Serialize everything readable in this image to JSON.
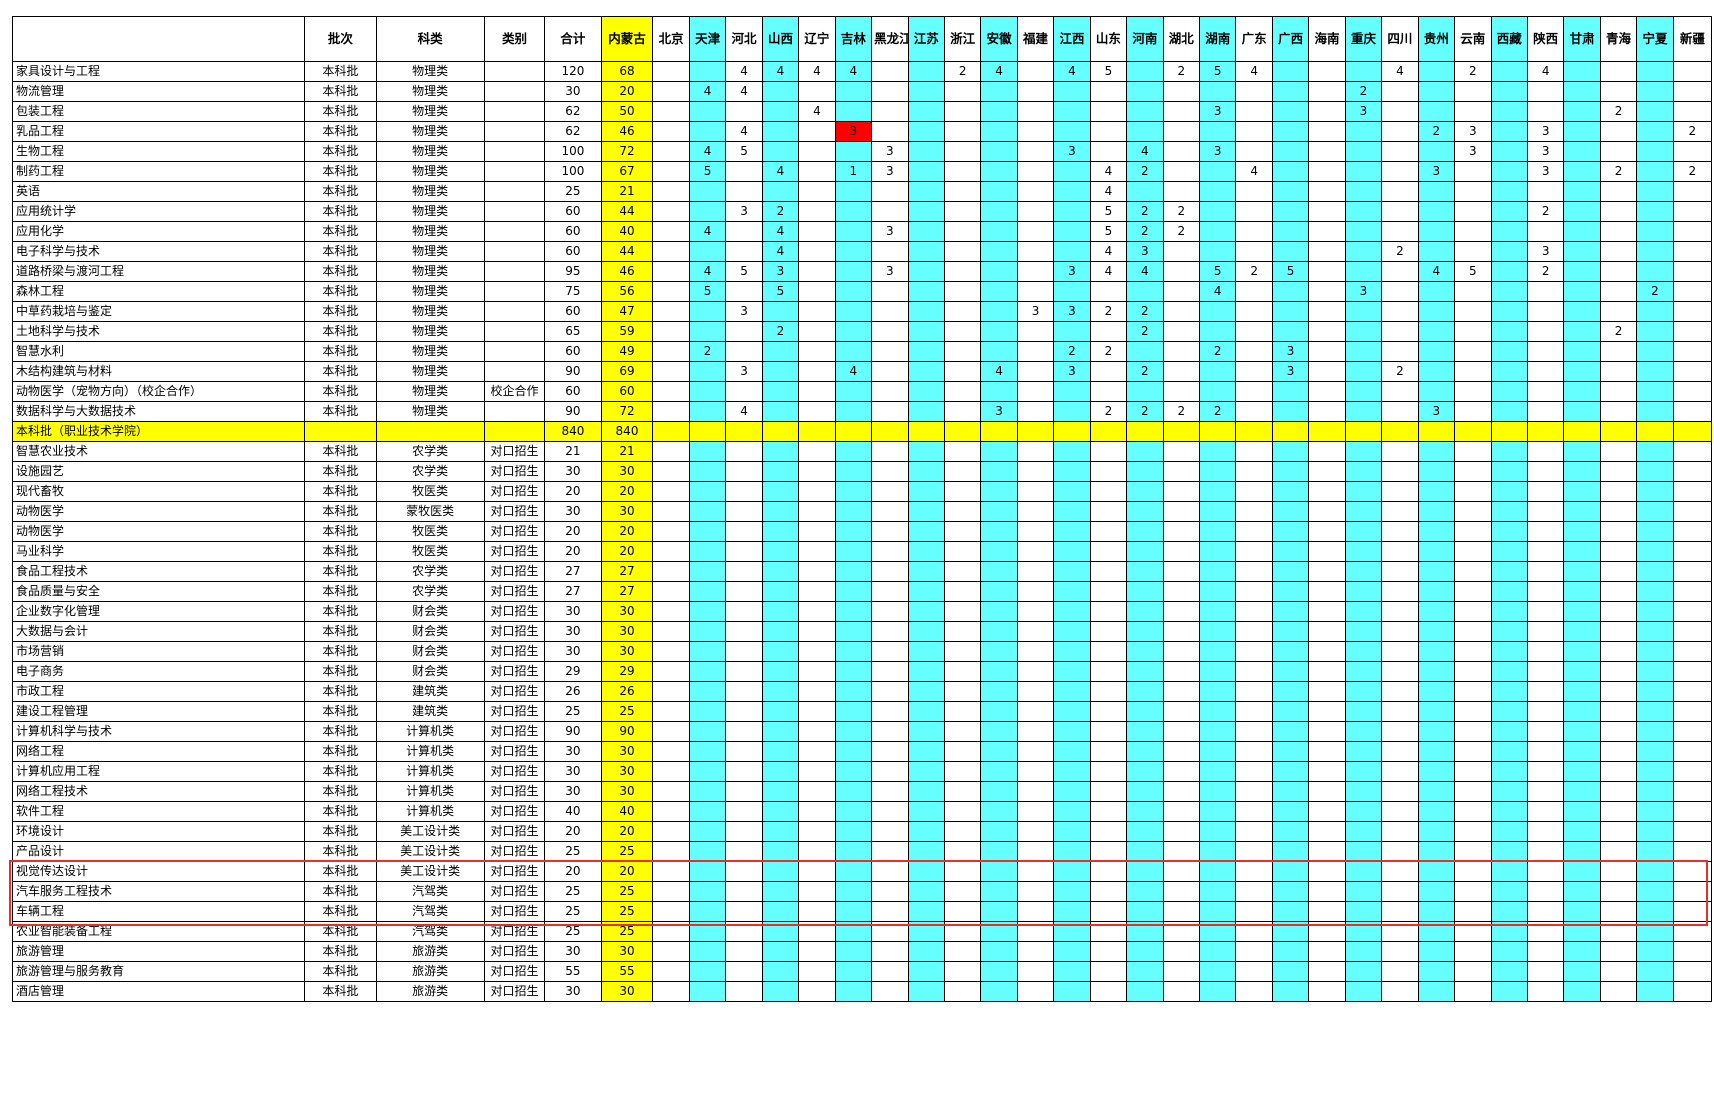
{
  "headers": [
    "",
    "批次",
    "科类",
    "类别",
    "合计",
    "内蒙古",
    "北京",
    "天津",
    "河北",
    "山西",
    "辽宁",
    "吉林",
    "黑龙江",
    "江苏",
    "浙江",
    "安徽",
    "福建",
    "江西",
    "山东",
    "河南",
    "湖北",
    "湖南",
    "广东",
    "广西",
    "海南",
    "重庆",
    "四川",
    "贵州",
    "云南",
    "西藏",
    "陕西",
    "甘肃",
    "青海",
    "宁夏",
    "新疆"
  ],
  "cyan_columns": [
    7,
    9,
    11,
    13,
    15,
    17,
    19,
    21,
    23,
    25,
    27,
    29,
    31,
    33
  ],
  "yellow_column": 5,
  "colors": {
    "cyan": "#66ffff",
    "yellow": "#ffff00",
    "red": "#ff0000",
    "highlight_box": "#e8302a"
  },
  "highlight_box_rows": [
    40,
    42
  ],
  "rows": [
    {
      "cells": [
        "家具设计与工程",
        "本科批",
        "物理类",
        "",
        "120",
        "68",
        "",
        "",
        "4",
        "4",
        "4",
        "4",
        "",
        "",
        "2",
        "4",
        "",
        "4",
        "5",
        "",
        "2",
        "5",
        "4",
        "",
        "",
        "",
        "4",
        "",
        "2",
        "",
        "4",
        "",
        "",
        "",
        ""
      ]
    },
    {
      "cells": [
        "物流管理",
        "本科批",
        "物理类",
        "",
        "30",
        "20",
        "",
        "4",
        "4",
        "",
        "",
        "",
        "",
        "",
        "",
        "",
        "",
        "",
        "",
        "",
        "",
        "",
        "",
        "",
        "",
        "2",
        "",
        "",
        "",
        "",
        "",
        "",
        "",
        "",
        ""
      ]
    },
    {
      "cells": [
        "包装工程",
        "本科批",
        "物理类",
        "",
        "62",
        "50",
        "",
        "",
        "",
        "",
        "4",
        "",
        "",
        "",
        "",
        "",
        "",
        "",
        "",
        "",
        "",
        "3",
        "",
        "",
        "",
        "3",
        "",
        "",
        "",
        "",
        "",
        "",
        "2",
        "",
        ""
      ]
    },
    {
      "cells": [
        "乳品工程",
        "本科批",
        "物理类",
        "",
        "62",
        "46",
        "",
        "",
        "4",
        "",
        "",
        "3",
        "",
        "",
        "",
        "",
        "",
        "",
        "",
        "",
        "",
        "",
        "",
        "",
        "",
        "",
        "",
        "2",
        "3",
        "",
        "3",
        "",
        "",
        "",
        "2"
      ],
      "red_cols": [
        11
      ]
    },
    {
      "cells": [
        "生物工程",
        "本科批",
        "物理类",
        "",
        "100",
        "72",
        "",
        "4",
        "5",
        "",
        "",
        "",
        "3",
        "",
        "",
        "",
        "",
        "3",
        "",
        "4",
        "",
        "3",
        "",
        "",
        "",
        "",
        "",
        "",
        "3",
        "",
        "3",
        "",
        "",
        "",
        ""
      ]
    },
    {
      "cells": [
        "制药工程",
        "本科批",
        "物理类",
        "",
        "100",
        "67",
        "",
        "5",
        "",
        "4",
        "",
        "1",
        "3",
        "",
        "",
        "",
        "",
        "",
        "4",
        "2",
        "",
        "",
        "4",
        "",
        "",
        "",
        "",
        "3",
        "",
        "",
        "3",
        "",
        "2",
        "",
        "2"
      ]
    },
    {
      "cells": [
        "英语",
        "本科批",
        "物理类",
        "",
        "25",
        "21",
        "",
        "",
        "",
        "",
        "",
        "",
        "",
        "",
        "",
        "",
        "",
        "",
        "4",
        "",
        "",
        "",
        "",
        "",
        "",
        "",
        "",
        "",
        "",
        "",
        "",
        "",
        "",
        "",
        ""
      ]
    },
    {
      "cells": [
        "应用统计学",
        "本科批",
        "物理类",
        "",
        "60",
        "44",
        "",
        "",
        "3",
        "2",
        "",
        "",
        "",
        "",
        "",
        "",
        "",
        "",
        "5",
        "2",
        "2",
        "",
        "",
        "",
        "",
        "",
        "",
        "",
        "",
        "",
        "2",
        "",
        "",
        "",
        ""
      ]
    },
    {
      "cells": [
        "应用化学",
        "本科批",
        "物理类",
        "",
        "60",
        "40",
        "",
        "4",
        "",
        "4",
        "",
        "",
        "3",
        "",
        "",
        "",
        "",
        "",
        "5",
        "2",
        "2",
        "",
        "",
        "",
        "",
        "",
        "",
        "",
        "",
        "",
        "",
        "",
        "",
        "",
        ""
      ]
    },
    {
      "cells": [
        "电子科学与技术",
        "本科批",
        "物理类",
        "",
        "60",
        "44",
        "",
        "",
        "",
        "4",
        "",
        "",
        "",
        "",
        "",
        "",
        "",
        "",
        "4",
        "3",
        "",
        "",
        "",
        "",
        "",
        "",
        "2",
        "",
        "",
        "",
        "3",
        "",
        "",
        "",
        ""
      ]
    },
    {
      "cells": [
        "道路桥梁与渡河工程",
        "本科批",
        "物理类",
        "",
        "95",
        "46",
        "",
        "4",
        "5",
        "3",
        "",
        "",
        "3",
        "",
        "",
        "",
        "",
        "3",
        "4",
        "4",
        "",
        "5",
        "2",
        "5",
        "",
        "",
        "",
        "4",
        "5",
        "",
        "2",
        "",
        "",
        "",
        ""
      ]
    },
    {
      "cells": [
        "森林工程",
        "本科批",
        "物理类",
        "",
        "75",
        "56",
        "",
        "5",
        "",
        "5",
        "",
        "",
        "",
        "",
        "",
        "",
        "",
        "",
        "",
        "",
        "",
        "4",
        "",
        "",
        "",
        "3",
        "",
        "",
        "",
        "",
        "",
        "",
        "",
        "2",
        ""
      ]
    },
    {
      "cells": [
        "中草药栽培与鉴定",
        "本科批",
        "物理类",
        "",
        "60",
        "47",
        "",
        "",
        "3",
        "",
        "",
        "",
        "",
        "",
        "",
        "",
        "3",
        "3",
        "2",
        "2",
        "",
        "",
        "",
        "",
        "",
        "",
        "",
        "",
        "",
        "",
        "",
        "",
        "",
        "",
        ""
      ]
    },
    {
      "cells": [
        "土地科学与技术",
        "本科批",
        "物理类",
        "",
        "65",
        "59",
        "",
        "",
        "",
        "2",
        "",
        "",
        "",
        "",
        "",
        "",
        "",
        "",
        "",
        "2",
        "",
        "",
        "",
        "",
        "",
        "",
        "",
        "",
        "",
        "",
        "",
        "",
        "2",
        "",
        ""
      ]
    },
    {
      "cells": [
        "智慧水利",
        "本科批",
        "物理类",
        "",
        "60",
        "49",
        "",
        "2",
        "",
        "",
        "",
        "",
        "",
        "",
        "",
        "",
        "",
        "2",
        "2",
        "",
        "",
        "2",
        "",
        "3",
        "",
        "",
        "",
        "",
        "",
        "",
        "",
        "",
        "",
        "",
        ""
      ]
    },
    {
      "cells": [
        "木结构建筑与材料",
        "本科批",
        "物理类",
        "",
        "90",
        "69",
        "",
        "",
        "3",
        "",
        "",
        "4",
        "",
        "",
        "",
        "4",
        "",
        "3",
        "",
        "2",
        "",
        "",
        "",
        "3",
        "",
        "",
        "2",
        "",
        "",
        "",
        "",
        "",
        "",
        "",
        ""
      ]
    },
    {
      "cells": [
        "动物医学（宠物方向）（校企合作）",
        "本科批",
        "物理类",
        "校企合作",
        "60",
        "60",
        "",
        "",
        "",
        "",
        "",
        "",
        "",
        "",
        "",
        "",
        "",
        "",
        "",
        "",
        "",
        "",
        "",
        "",
        "",
        "",
        "",
        "",
        "",
        "",
        "",
        "",
        "",
        "",
        ""
      ]
    },
    {
      "cells": [
        "数据科学与大数据技术",
        "本科批",
        "物理类",
        "",
        "90",
        "72",
        "",
        "",
        "4",
        "",
        "",
        "",
        "",
        "",
        "",
        "3",
        "",
        "",
        "2",
        "2",
        "2",
        "2",
        "",
        "",
        "",
        "",
        "",
        "3",
        "",
        "",
        "",
        "",
        "",
        "",
        ""
      ]
    },
    {
      "section": true,
      "cells": [
        "本科批（职业技术学院）",
        "",
        "",
        "",
        "840",
        "840"
      ]
    },
    {
      "cells": [
        "智慧农业技术",
        "本科批",
        "农学类",
        "对口招生",
        "21",
        "21"
      ]
    },
    {
      "cells": [
        "设施园艺",
        "本科批",
        "农学类",
        "对口招生",
        "30",
        "30"
      ]
    },
    {
      "cells": [
        "现代畜牧",
        "本科批",
        "牧医类",
        "对口招生",
        "20",
        "20"
      ]
    },
    {
      "cells": [
        "动物医学",
        "本科批",
        "蒙牧医类",
        "对口招生",
        "30",
        "30"
      ]
    },
    {
      "cells": [
        "动物医学",
        "本科批",
        "牧医类",
        "对口招生",
        "20",
        "20"
      ]
    },
    {
      "cells": [
        "马业科学",
        "本科批",
        "牧医类",
        "对口招生",
        "20",
        "20"
      ]
    },
    {
      "cells": [
        "食品工程技术",
        "本科批",
        "农学类",
        "对口招生",
        "27",
        "27"
      ]
    },
    {
      "cells": [
        "食品质量与安全",
        "本科批",
        "农学类",
        "对口招生",
        "27",
        "27"
      ]
    },
    {
      "cells": [
        "企业数字化管理",
        "本科批",
        "财会类",
        "对口招生",
        "30",
        "30"
      ]
    },
    {
      "cells": [
        "大数据与会计",
        "本科批",
        "财会类",
        "对口招生",
        "30",
        "30"
      ]
    },
    {
      "cells": [
        "市场营销",
        "本科批",
        "财会类",
        "对口招生",
        "30",
        "30"
      ]
    },
    {
      "cells": [
        "电子商务",
        "本科批",
        "财会类",
        "对口招生",
        "29",
        "29"
      ]
    },
    {
      "cells": [
        "市政工程",
        "本科批",
        "建筑类",
        "对口招生",
        "26",
        "26"
      ]
    },
    {
      "cells": [
        "建设工程管理",
        "本科批",
        "建筑类",
        "对口招生",
        "25",
        "25"
      ]
    },
    {
      "cells": [
        "计算机科学与技术",
        "本科批",
        "计算机类",
        "对口招生",
        "90",
        "90"
      ]
    },
    {
      "cells": [
        "网络工程",
        "本科批",
        "计算机类",
        "对口招生",
        "30",
        "30"
      ]
    },
    {
      "cells": [
        "计算机应用工程",
        "本科批",
        "计算机类",
        "对口招生",
        "30",
        "30"
      ]
    },
    {
      "cells": [
        "网络工程技术",
        "本科批",
        "计算机类",
        "对口招生",
        "30",
        "30"
      ]
    },
    {
      "cells": [
        "软件工程",
        "本科批",
        "计算机类",
        "对口招生",
        "40",
        "40"
      ]
    },
    {
      "cells": [
        "环境设计",
        "本科批",
        "美工设计类",
        "对口招生",
        "20",
        "20"
      ]
    },
    {
      "cells": [
        "产品设计",
        "本科批",
        "美工设计类",
        "对口招生",
        "25",
        "25"
      ]
    },
    {
      "cells": [
        "视觉传达设计",
        "本科批",
        "美工设计类",
        "对口招生",
        "20",
        "20"
      ]
    },
    {
      "cells": [
        "汽车服务工程技术",
        "本科批",
        "汽驾类",
        "对口招生",
        "25",
        "25"
      ]
    },
    {
      "cells": [
        "车辆工程",
        "本科批",
        "汽驾类",
        "对口招生",
        "25",
        "25"
      ]
    },
    {
      "cells": [
        "农业智能装备工程",
        "本科批",
        "汽驾类",
        "对口招生",
        "25",
        "25"
      ]
    },
    {
      "cells": [
        "旅游管理",
        "本科批",
        "旅游类",
        "对口招生",
        "30",
        "30"
      ]
    },
    {
      "cells": [
        "旅游管理与服务教育",
        "本科批",
        "旅游类",
        "对口招生",
        "55",
        "55"
      ]
    },
    {
      "cells": [
        "酒店管理",
        "本科批",
        "旅游类",
        "对口招生",
        "30",
        "30"
      ]
    }
  ]
}
